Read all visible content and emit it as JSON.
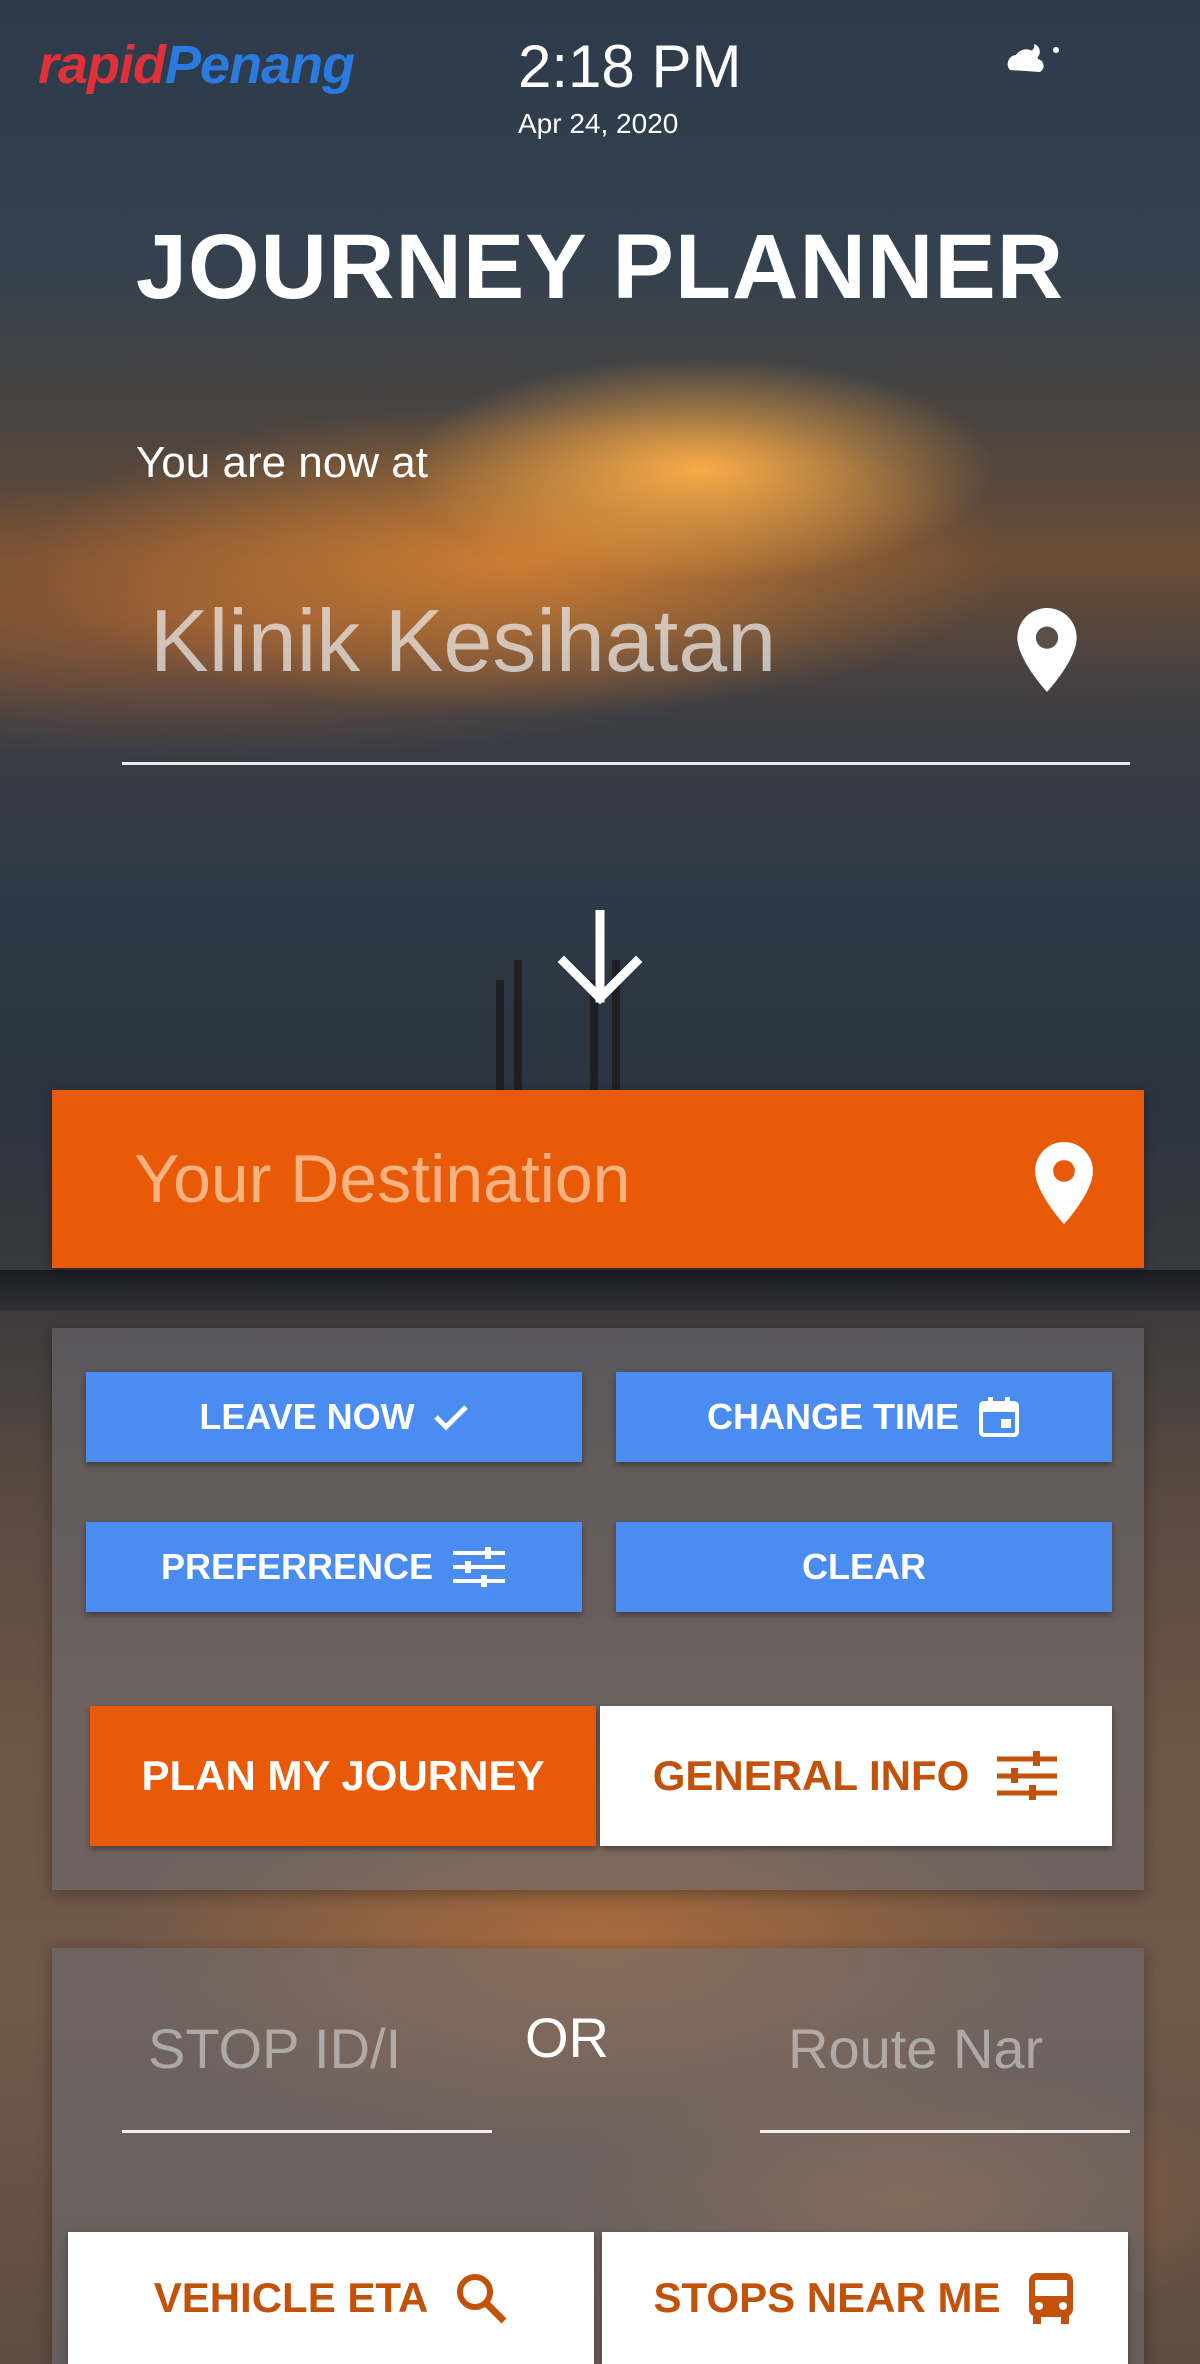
{
  "status_bar": {
    "brand_part1": "rapid",
    "brand_part2": "Penang",
    "time": "2:18 PM",
    "date": "Apr 24, 2020",
    "weather_icon": "cloudy-night-icon"
  },
  "header": {
    "title": "JOURNEY PLANNER"
  },
  "origin": {
    "label": "You are now at",
    "value": "Klinik Kesihatan",
    "icon": "location-pin-icon"
  },
  "direction_icon": "arrow-down-icon",
  "destination": {
    "placeholder": "Your Destination",
    "icon": "location-pin-icon"
  },
  "options": {
    "leave_now": "LEAVE NOW",
    "leave_now_icon": "check-icon",
    "change_time": "CHANGE TIME",
    "change_time_icon": "calendar-icon",
    "preference": "PREFERRENCE",
    "preference_icon": "sliders-icon",
    "clear": "CLEAR"
  },
  "actions": {
    "plan": "PLAN MY JOURNEY",
    "general_info": "GENERAL INFO",
    "general_info_icon": "sliders-icon"
  },
  "lookup": {
    "stop_placeholder": "STOP ID/I",
    "separator": "OR",
    "route_placeholder": "Route Nar"
  },
  "bottom_buttons": {
    "vehicle_eta": "VEHICLE ETA",
    "vehicle_eta_icon": "search-icon",
    "stops_near_me": "STOPS NEAR ME",
    "stops_near_me_icon": "bus-icon"
  },
  "colors": {
    "accent_orange": "#e85a08",
    "button_blue": "#4a8cf0",
    "brand_red": "#e0303a",
    "brand_blue": "#2a7ae0",
    "orange_text": "#c2520a"
  }
}
